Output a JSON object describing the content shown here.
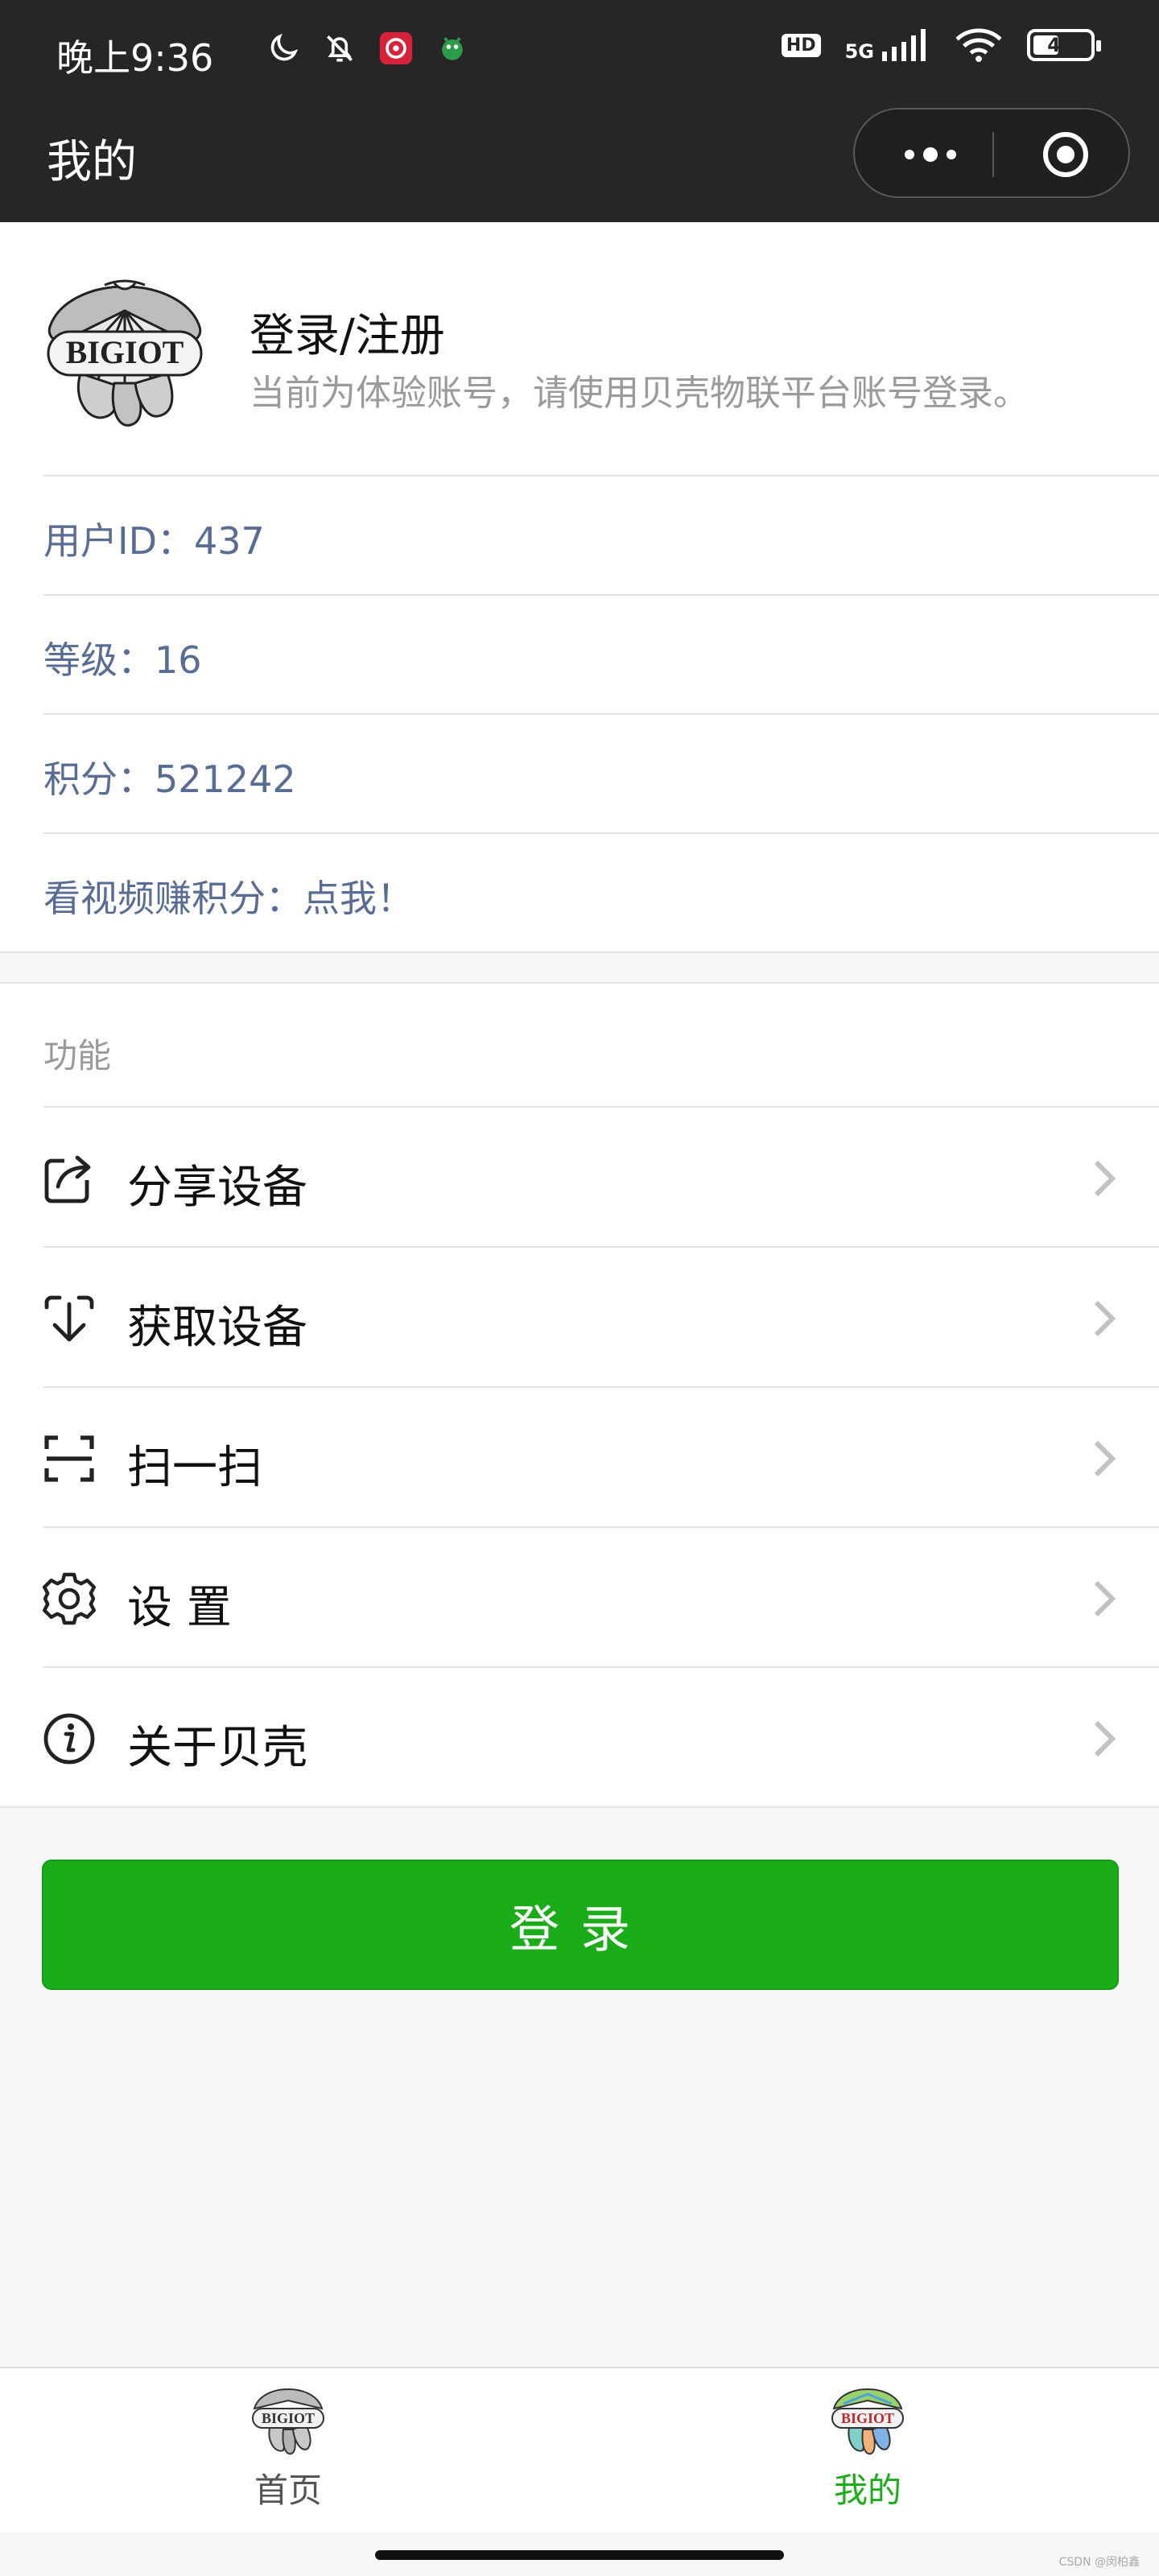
{
  "status_bar": {
    "time": "晚上9:36",
    "hd": "HD",
    "network": "5G",
    "battery": "45",
    "battery_level": 0.45
  },
  "nav": {
    "title": "我的"
  },
  "profile": {
    "logo_text": "BIGIOT",
    "login_title": "登录/注册",
    "subtitle": "当前为体验账号，请使用贝壳物联平台账号登录。"
  },
  "info": [
    {
      "text": "用户ID：437"
    },
    {
      "text": "等级：16"
    },
    {
      "text": "积分：521242"
    },
    {
      "text": "看视频赚积分：点我！"
    }
  ],
  "functions": {
    "label": "功能",
    "items": [
      {
        "label": "分享设备",
        "icon": "share-icon"
      },
      {
        "label": "获取设备",
        "icon": "download-icon"
      },
      {
        "label": "扫一扫",
        "icon": "scan-icon"
      },
      {
        "label": "设 置",
        "icon": "gear-icon"
      },
      {
        "label": "关于贝壳",
        "icon": "info-icon"
      }
    ]
  },
  "login_button": "登录",
  "tabs": [
    {
      "label": "首页",
      "logo_text": "BIGIOT",
      "active": false
    },
    {
      "label": "我的",
      "logo_text": "BIGIOT",
      "active": true
    }
  ],
  "watermark": "CSDN @闵柏鑫",
  "colors": {
    "header_bg": "#262626",
    "accent_green": "#1aad19",
    "info_blue": "#586c94"
  }
}
